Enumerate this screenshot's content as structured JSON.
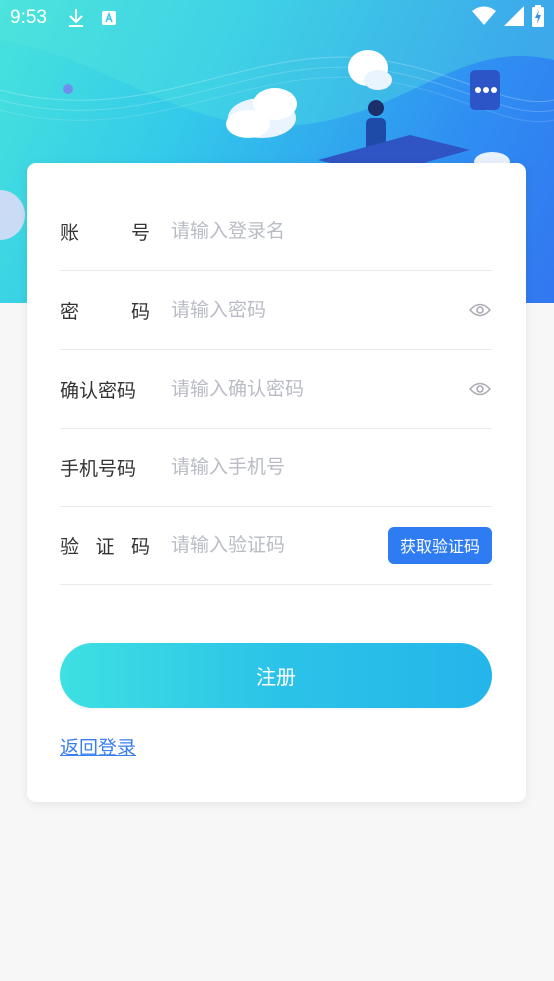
{
  "status_bar": {
    "time": "9:53"
  },
  "form": {
    "account": {
      "label_a": "账",
      "label_b": "号",
      "placeholder": "请输入登录名"
    },
    "password": {
      "label_a": "密",
      "label_b": "码",
      "placeholder": "请输入密码"
    },
    "confirm_password": {
      "label": "确认密码",
      "placeholder": "请输入确认密码"
    },
    "phone": {
      "label": "手机号码",
      "placeholder": "请输入手机号"
    },
    "code": {
      "label_a": "验",
      "label_b": "证",
      "label_c": "码",
      "placeholder": "请输入验证码",
      "button": "获取验证码"
    },
    "register_button": "注册",
    "back_link": "返回登录"
  },
  "colors": {
    "accent": "#2f7cf2",
    "placeholder": "#b9bcc4",
    "label": "#333333"
  }
}
